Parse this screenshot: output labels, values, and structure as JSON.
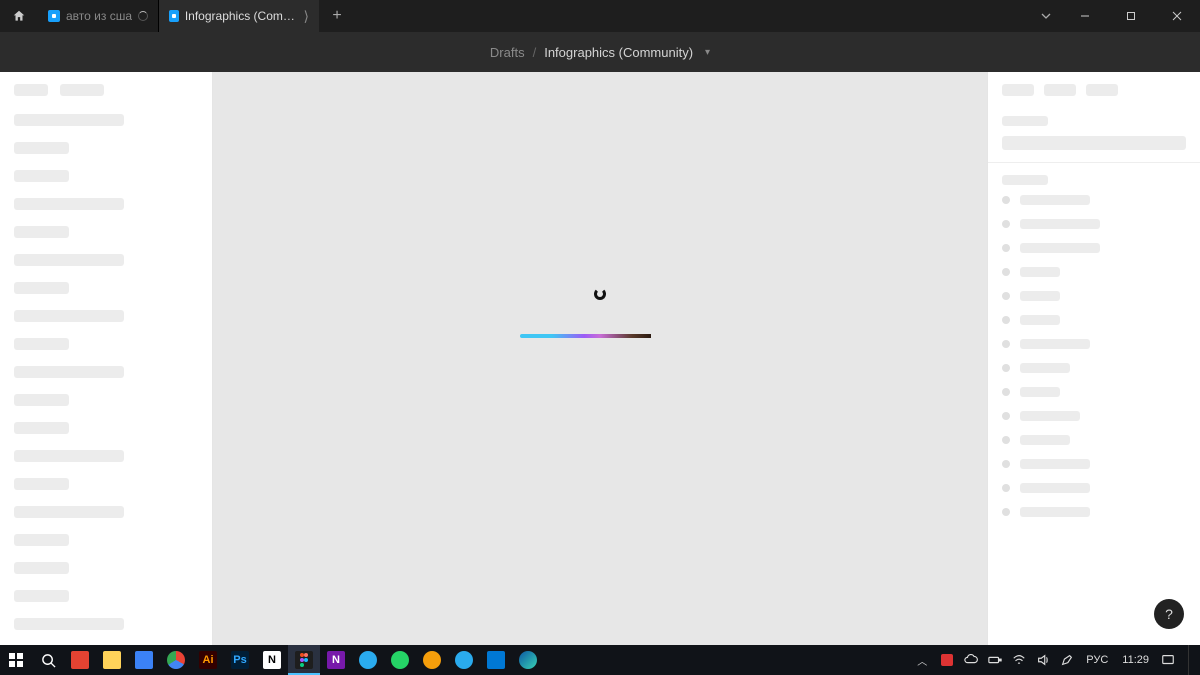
{
  "tabs": [
    {
      "title": "авто из сша",
      "active": false,
      "loading": true
    },
    {
      "title": "Infographics (Community)",
      "active": true,
      "loading": false
    }
  ],
  "breadcrumbs": {
    "root": "Drafts",
    "file": "Infographics (Community)"
  },
  "help_label": "?",
  "taskbar": {
    "lang": "РУС",
    "time": "11:29"
  }
}
